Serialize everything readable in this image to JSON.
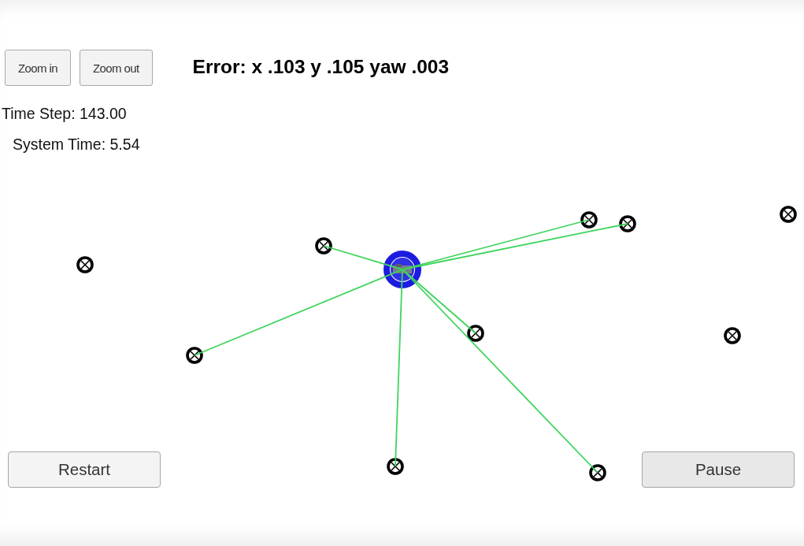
{
  "toolbar": {
    "buttons": [
      {
        "label": "Zoom in"
      },
      {
        "label": "Zoom out"
      }
    ]
  },
  "error": "Error: x .103 y .105 yaw .003",
  "time_step": "Time Step: 143.00",
  "system_time": "System Time: 5.54",
  "controls": [
    {
      "label": "Restart",
      "pressed": false
    },
    {
      "label": "Pause",
      "pressed": true
    }
  ]
}
